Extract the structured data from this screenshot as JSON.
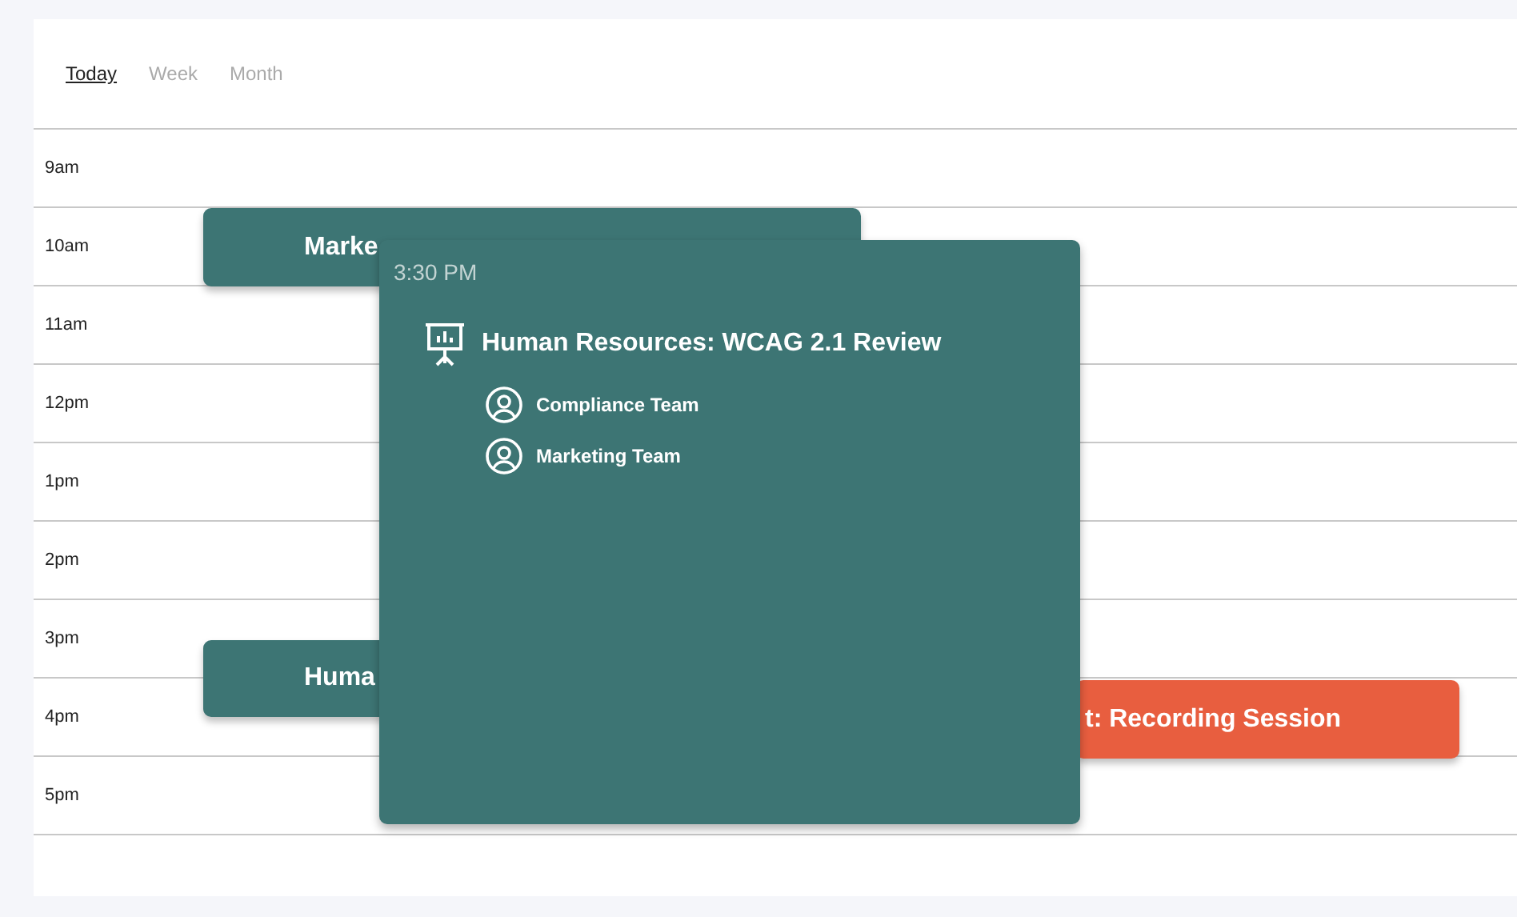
{
  "tabs": [
    {
      "label": "Today",
      "selected": true
    },
    {
      "label": "Week",
      "selected": false
    },
    {
      "label": "Month",
      "selected": false
    }
  ],
  "hours": [
    "9am",
    "10am",
    "11am",
    "12pm",
    "1pm",
    "2pm",
    "3pm",
    "4pm",
    "5pm"
  ],
  "events": [
    {
      "title": "Marke",
      "color": "#3d7574"
    },
    {
      "title": "Huma",
      "color": "#3d7574"
    },
    {
      "title": "t: Recording Session",
      "color": "#e85e3f"
    }
  ],
  "popup": {
    "time": "3:30 PM",
    "title": "Human Resources: WCAG 2.1 Review",
    "attendees": [
      "Compliance Team",
      "Marketing Team"
    ]
  }
}
